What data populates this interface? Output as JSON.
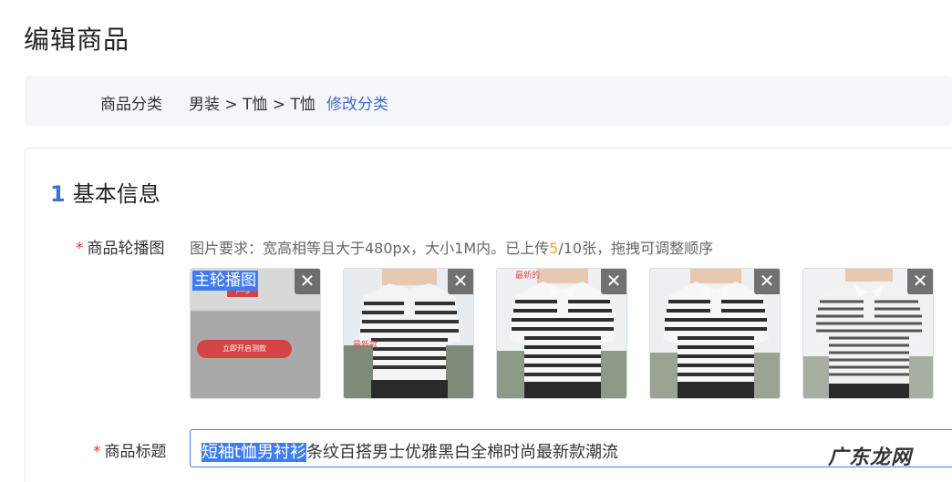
{
  "page": {
    "title": "编辑商品"
  },
  "category": {
    "label": "商品分类",
    "path": "男装 > T恤 > T恤",
    "edit_link": "修改分类"
  },
  "section": {
    "number": "1",
    "title": "基本信息"
  },
  "carousel": {
    "required_mark": "*",
    "label": "商品轮播图",
    "hint_prefix": "图片要求：宽高相等且大于480px，大小1M内。已上传",
    "uploaded_count": "5",
    "hint_suffix": "/10张，拖拽可调整顺序",
    "main_tag": "主轮播图",
    "delete_glyph": "✕",
    "cover_button_text": "立即开启测款",
    "cover_mini_text": "下一步",
    "images": [
      {
        "type": "cover-screenshot"
      },
      {
        "type": "striped-polo",
        "overlay_text": "最新款"
      },
      {
        "type": "striped-polo",
        "overlay_text": "最新的"
      },
      {
        "type": "striped-polo",
        "overlay_text": ""
      },
      {
        "type": "striped-polo",
        "overlay_text": ""
      }
    ]
  },
  "product_title": {
    "required_mark": "*",
    "label": "商品标题",
    "selected_text": "短袖t恤男衬衫",
    "rest_text": "条纹百搭男士优雅黑白全棉时尚最新款潮流"
  },
  "watermark": {
    "text": "广东龙网"
  },
  "colors": {
    "accent": "#3f7cf2",
    "link": "#3f6fd1",
    "required": "#e0362c",
    "count": "#f5a623"
  }
}
